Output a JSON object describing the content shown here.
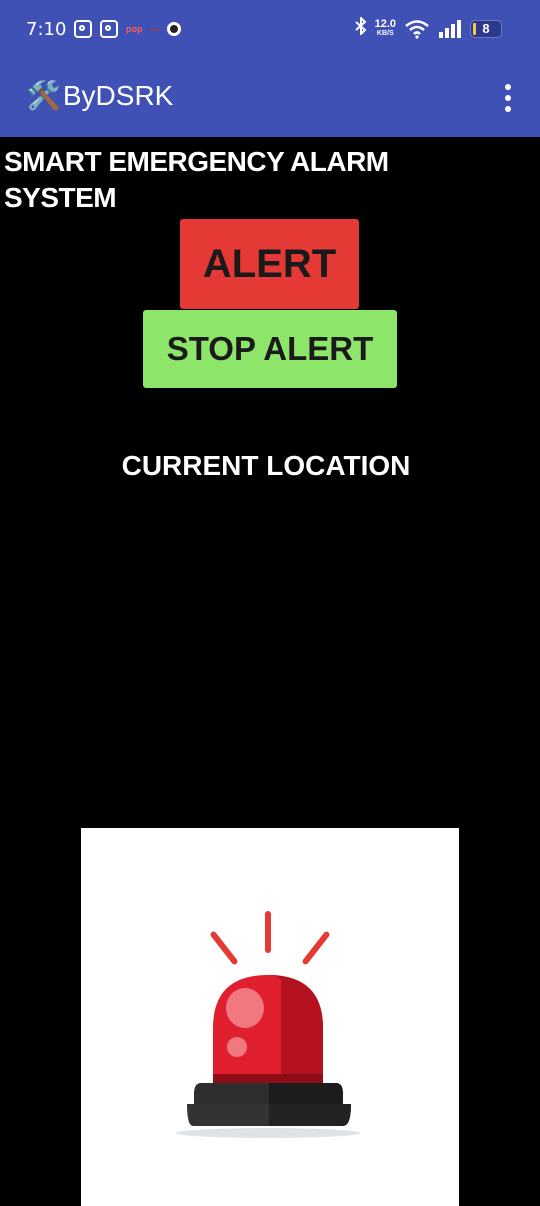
{
  "status_bar": {
    "time": "7:10",
    "left_icons": [
      "instagram-icon",
      "instagram-icon",
      "pop-icon",
      "notification-icon",
      "circle-app-icon"
    ],
    "pop_text": "pop",
    "dots_text": "•••",
    "net_speed": "12.0",
    "net_unit": "KB/S",
    "battery_level": "8"
  },
  "app_bar": {
    "icon": "hammer-wrench-icon",
    "title": "ByDSRK",
    "menu_icon": "overflow-menu-icon"
  },
  "main": {
    "heading": "SMART EMERGENCY ALARM SYSTEM",
    "alert_label": "ALERT",
    "stop_alert_label": "STOP ALERT",
    "location_label": "CURRENT LOCATION",
    "image": "siren-icon"
  },
  "colors": {
    "app_bar": "#3f51b5",
    "background": "#000000",
    "alert_button": "#e53935",
    "stop_button": "#8de66a"
  }
}
